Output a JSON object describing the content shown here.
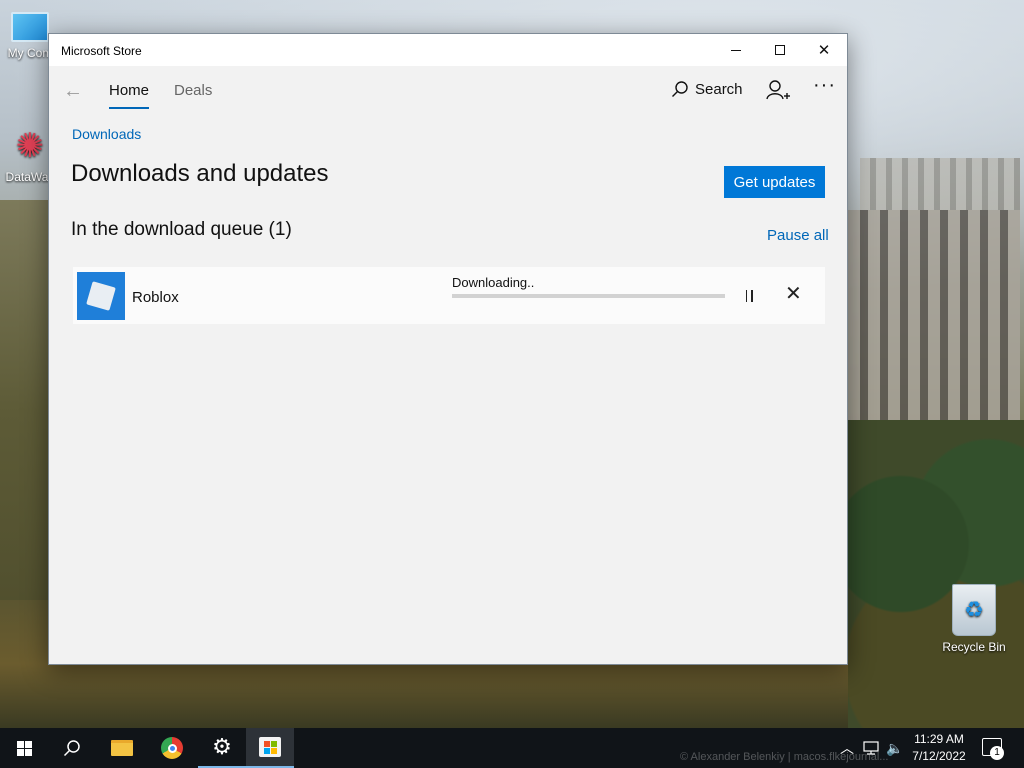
{
  "desktop": {
    "icons": [
      {
        "label": "My Com"
      },
      {
        "label": "DataWac"
      },
      {
        "label": "Recycle Bin"
      }
    ],
    "watermark": "© Alexander Belenkiy | macos.flkejournal..."
  },
  "window": {
    "title": "Microsoft Store",
    "controls": {
      "minimize": "minimize",
      "maximize": "maximize",
      "close": "close"
    }
  },
  "nav": {
    "back_icon": "back-arrow-icon",
    "tabs": [
      {
        "label": "Home",
        "active": true
      },
      {
        "label": "Deals",
        "active": false
      }
    ],
    "search_label": "Search",
    "more_label": "···"
  },
  "page": {
    "breadcrumb": "Downloads",
    "title": "Downloads and updates",
    "get_updates_label": "Get updates",
    "queue_title": "In the download queue (1)",
    "pause_all_label": "Pause all",
    "items": [
      {
        "name": "Roblox",
        "status": "Downloading..",
        "progress": 0.0
      }
    ]
  },
  "taskbar": {
    "apps": [
      "start",
      "search",
      "file-explorer",
      "chrome",
      "settings",
      "microsoft-store"
    ],
    "time": "11:29 AM",
    "date": "7/12/2022",
    "notification_count": "1"
  },
  "colors": {
    "accent": "#0078d7",
    "link": "#0067b8",
    "window_bg": "#f2f2f2",
    "taskbar_bg": "#101418"
  }
}
